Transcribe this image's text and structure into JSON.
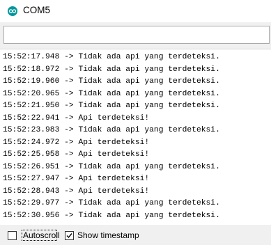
{
  "window": {
    "title": "COM5"
  },
  "send": {
    "value": ""
  },
  "output": {
    "lines": [
      "15:52:17.948 -> Tidak ada api yang terdeteksi.",
      "15:52:18.972 -> Tidak ada api yang terdeteksi.",
      "15:52:19.960 -> Tidak ada api yang terdeteksi.",
      "15:52:20.965 -> Tidak ada api yang terdeteksi.",
      "15:52:21.950 -> Tidak ada api yang terdeteksi.",
      "15:52:22.941 -> Api terdeteksi!",
      "15:52:23.983 -> Tidak ada api yang terdeteksi.",
      "15:52:24.972 -> Api terdeteksi!",
      "15:52:25.958 -> Api terdeteksi!",
      "15:52:26.951 -> Tidak ada api yang terdeteksi.",
      "15:52:27.947 -> Api terdeteksi!",
      "15:52:28.943 -> Api terdeteksi!",
      "15:52:29.977 -> Tidak ada api yang terdeteksi.",
      "15:52:30.956 -> Tidak ada api yang terdeteksi."
    ]
  },
  "footer": {
    "autoscroll": {
      "label": "Autoscroll",
      "checked": false
    },
    "show_timestamp": {
      "label": "Show timestamp",
      "checked": true
    }
  },
  "colors": {
    "accent": "#00979c",
    "chrome": "#f0f0f0"
  },
  "icons": {
    "app": "arduino-icon",
    "check": "checkmark-icon"
  }
}
